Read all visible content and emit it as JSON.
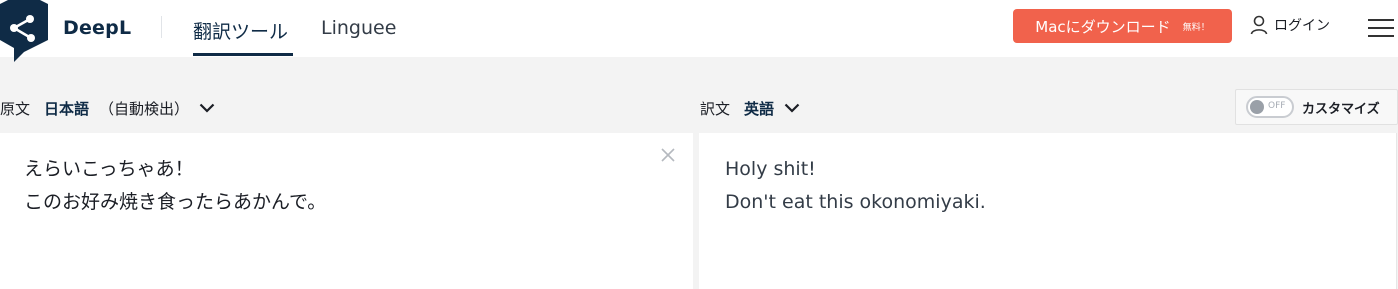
{
  "header": {
    "brand": "DeepL",
    "tabs": [
      {
        "label": "翻訳ツール",
        "active": true
      },
      {
        "label": "Linguee",
        "active": false
      }
    ],
    "download_label": "Macにダウンロード",
    "download_badge": "無料！",
    "login_label": "ログイン"
  },
  "source": {
    "prefix": "原文",
    "language": "日本語",
    "detected_note": "（自動検出）",
    "text": "えらいこっちゃあ！\nこのお好み焼き食ったらあかんで。"
  },
  "target": {
    "prefix": "訳文",
    "language": "英語",
    "text": "Holy shit!\nDon't eat this okonomiyaki."
  },
  "customize": {
    "toggle_state": "OFF",
    "label": "カスタマイズ"
  },
  "colors": {
    "brand_navy": "#0f2b46",
    "download_button": "#f1624c",
    "background": "#f3f3f3"
  },
  "icons": {
    "logo": "deepl-logo-icon",
    "user": "user-icon",
    "menu": "hamburger-menu-icon",
    "clear": "close-icon",
    "dropdown": "chevron-down-icon"
  }
}
